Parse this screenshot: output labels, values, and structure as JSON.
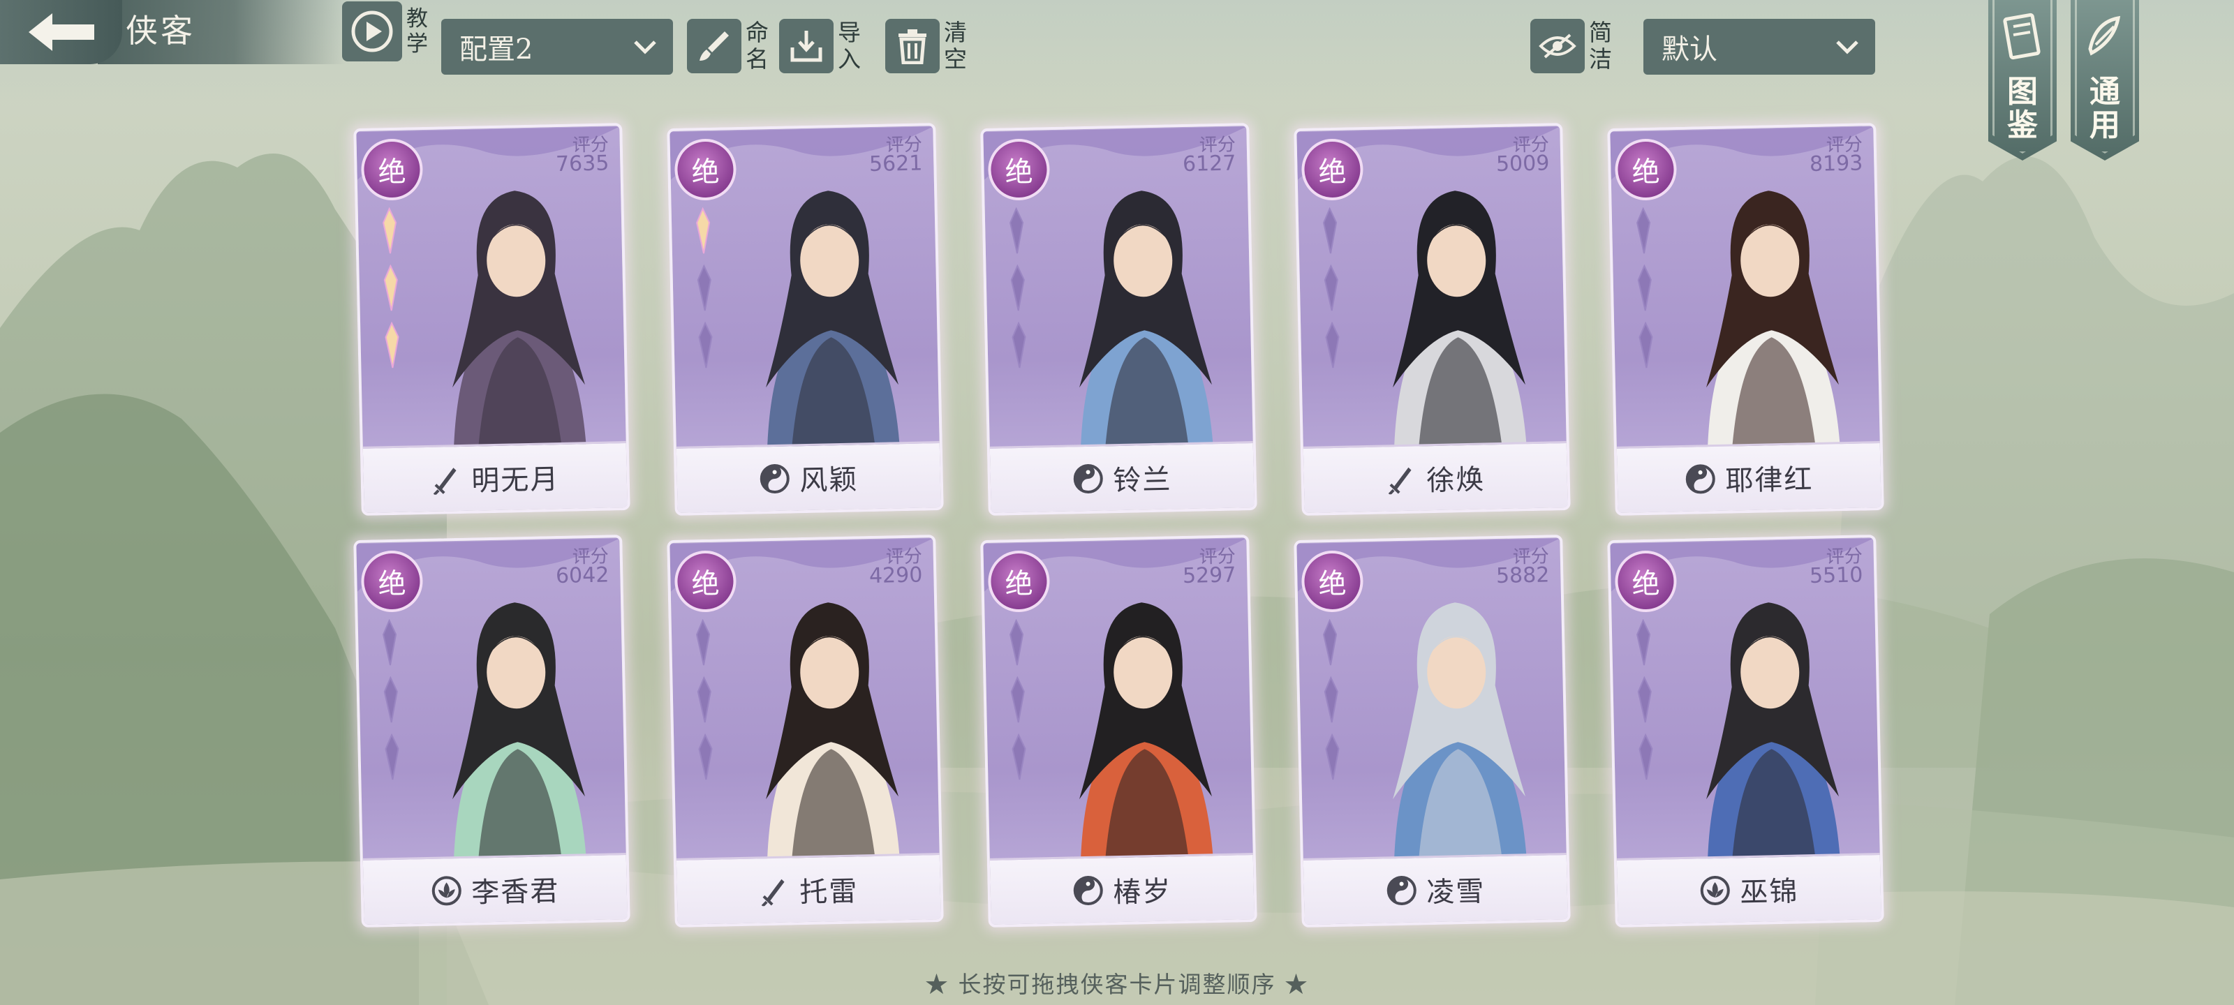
{
  "header": {
    "title": "侠客",
    "tutorial_label": [
      "教",
      "学"
    ],
    "config_dropdown": {
      "value": "配置2"
    },
    "rename_label": [
      "命",
      "名"
    ],
    "import_label": [
      "导",
      "入"
    ],
    "clear_label": [
      "清",
      "空"
    ],
    "simple_label": [
      "简",
      "洁"
    ],
    "sort_dropdown": {
      "value": "默认"
    }
  },
  "side_banners": [
    {
      "label": [
        "图",
        "鉴"
      ]
    },
    {
      "label": [
        "通",
        "用"
      ]
    }
  ],
  "cards": [
    {
      "name": "明无月",
      "score_label": "评分",
      "score": "7635",
      "tier": "绝",
      "class_icon": "sword-icon",
      "stars_lit": 3
    },
    {
      "name": "风颖",
      "score_label": "评分",
      "score": "5621",
      "tier": "绝",
      "class_icon": "taiji-icon",
      "stars_lit": 1
    },
    {
      "name": "铃兰",
      "score_label": "评分",
      "score": "6127",
      "tier": "绝",
      "class_icon": "taiji-icon",
      "stars_lit": 0
    },
    {
      "name": "徐焕",
      "score_label": "评分",
      "score": "5009",
      "tier": "绝",
      "class_icon": "sword-icon",
      "stars_lit": 0
    },
    {
      "name": "耶律红",
      "score_label": "评分",
      "score": "8193",
      "tier": "绝",
      "class_icon": "taiji-icon",
      "stars_lit": 0
    },
    {
      "name": "李香君",
      "score_label": "评分",
      "score": "6042",
      "tier": "绝",
      "class_icon": "lotus-icon",
      "stars_lit": 0
    },
    {
      "name": "托雷",
      "score_label": "评分",
      "score": "4290",
      "tier": "绝",
      "class_icon": "sword-icon",
      "stars_lit": 0
    },
    {
      "name": "椿岁",
      "score_label": "评分",
      "score": "5297",
      "tier": "绝",
      "class_icon": "taiji-icon",
      "stars_lit": 0
    },
    {
      "name": "凌雪",
      "score_label": "评分",
      "score": "5882",
      "tier": "绝",
      "class_icon": "taiji-icon",
      "stars_lit": 0
    },
    {
      "name": "巫锦",
      "score_label": "评分",
      "score": "5510",
      "tier": "绝",
      "class_icon": "lotus-icon",
      "stars_lit": 0
    }
  ],
  "hint": "★ 长按可拖拽侠客卡片调整顺序 ★",
  "colors": {
    "card_purple": "#ac9acf",
    "tier_badge": "#8a3f93",
    "toolbar_slate": "#5b6f6c"
  }
}
